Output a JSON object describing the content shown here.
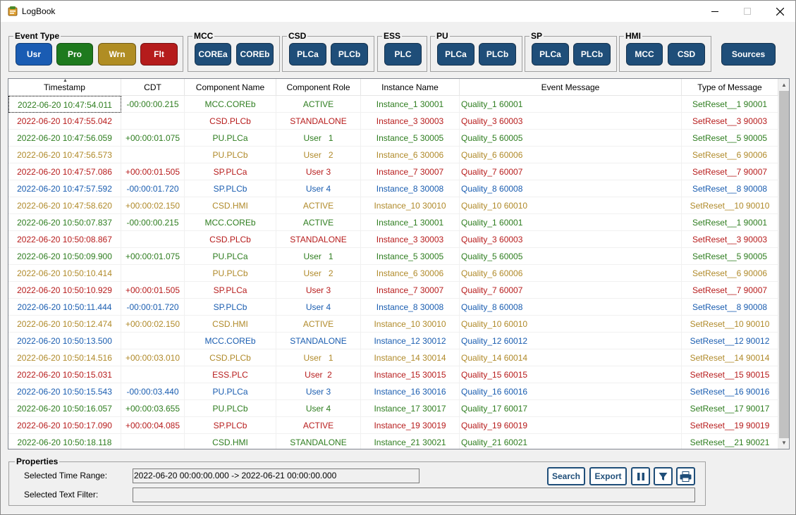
{
  "window": {
    "title": "LogBook"
  },
  "colors": {
    "blue": "#1a5db0",
    "green": "#2e7d1f",
    "yellow": "#b08a2a",
    "red": "#b71c1c",
    "navy": "#1f4e79"
  },
  "groups": [
    {
      "label": "Event Type",
      "buttons": [
        {
          "label": "Usr",
          "color": "#1a5cb3"
        },
        {
          "label": "Pro",
          "color": "#1e7a1e"
        },
        {
          "label": "Wrn",
          "color": "#b08d23"
        },
        {
          "label": "Flt",
          "color": "#b51c1c"
        }
      ]
    },
    {
      "label": "MCC",
      "buttons": [
        {
          "label": "COREa"
        },
        {
          "label": "COREb"
        }
      ]
    },
    {
      "label": "CSD",
      "buttons": [
        {
          "label": "PLCa"
        },
        {
          "label": "PLCb"
        }
      ]
    },
    {
      "label": "ESS",
      "buttons": [
        {
          "label": "PLC"
        }
      ]
    },
    {
      "label": "PU",
      "buttons": [
        {
          "label": "PLCa"
        },
        {
          "label": "PLCb"
        }
      ]
    },
    {
      "label": "SP",
      "buttons": [
        {
          "label": "PLCa"
        },
        {
          "label": "PLCb"
        }
      ]
    },
    {
      "label": "HMI",
      "buttons": [
        {
          "label": "MCC"
        },
        {
          "label": "CSD"
        }
      ]
    }
  ],
  "sources_label": "Sources",
  "table": {
    "columns": [
      "Timestamp",
      "CDT",
      "Component Name",
      "Component Role",
      "Instance Name",
      "Event Message",
      "Type of Message"
    ],
    "rows": [
      {
        "color": "green",
        "cells": [
          "2022-06-20 10:47:54.011",
          "-00:00:00.215",
          "MCC.COREb",
          "ACTIVE",
          "Instance_1 30001",
          "Quality_1 60001",
          "SetReset__1 90001"
        ]
      },
      {
        "color": "red",
        "cells": [
          "2022-06-20 10:47:55.042",
          "",
          "CSD.PLCb",
          "STANDALONE",
          "Instance_3 30003",
          "Quality_3 60003",
          "SetReset__3 90003"
        ]
      },
      {
        "color": "green",
        "cells": [
          "2022-06-20 10:47:56.059",
          "+00:00:01.075",
          "PU.PLCa",
          "User   1",
          "Instance_5 30005",
          "Quality_5 60005",
          "SetReset__5 90005"
        ]
      },
      {
        "color": "yellow",
        "cells": [
          "2022-06-20 10:47:56.573",
          "",
          "PU.PLCb",
          "User   2",
          "Instance_6 30006",
          "Quality_6 60006",
          "SetReset__6 90006"
        ]
      },
      {
        "color": "red",
        "cells": [
          "2022-06-20 10:47:57.086",
          "+00:00:01.505",
          "SP.PLCa",
          "User 3",
          "Instance_7 30007",
          "Quality_7 60007",
          "SetReset__7 90007"
        ]
      },
      {
        "color": "blue",
        "cells": [
          "2022-06-20 10:47:57.592",
          "-00:00:01.720",
          "SP.PLCb",
          "User 4",
          "Instance_8 30008",
          "Quality_8 60008",
          "SetReset__8 90008"
        ]
      },
      {
        "color": "yellow",
        "cells": [
          "2022-06-20 10:47:58.620",
          "+00:00:02.150",
          "CSD.HMI",
          "ACTIVE",
          "Instance_10 30010",
          "Quality_10 60010",
          "SetReset__10 90010"
        ]
      },
      {
        "color": "green",
        "cells": [
          "2022-06-20 10:50:07.837",
          "-00:00:00.215",
          "MCC.COREb",
          "ACTIVE",
          "Instance_1 30001",
          "Quality_1 60001",
          "SetReset__1 90001"
        ]
      },
      {
        "color": "red",
        "cells": [
          "2022-06-20 10:50:08.867",
          "",
          "CSD.PLCb",
          "STANDALONE",
          "Instance_3 30003",
          "Quality_3 60003",
          "SetReset__3 90003"
        ]
      },
      {
        "color": "green",
        "cells": [
          "2022-06-20 10:50:09.900",
          "+00:00:01.075",
          "PU.PLCa",
          "User   1",
          "Instance_5 30005",
          "Quality_5 60005",
          "SetReset__5 90005"
        ]
      },
      {
        "color": "yellow",
        "cells": [
          "2022-06-20 10:50:10.414",
          "",
          "PU.PLCb",
          "User   2",
          "Instance_6 30006",
          "Quality_6 60006",
          "SetReset__6 90006"
        ]
      },
      {
        "color": "red",
        "cells": [
          "2022-06-20 10:50:10.929",
          "+00:00:01.505",
          "SP.PLCa",
          "User 3",
          "Instance_7 30007",
          "Quality_7 60007",
          "SetReset__7 90007"
        ]
      },
      {
        "color": "blue",
        "cells": [
          "2022-06-20 10:50:11.444",
          "-00:00:01.720",
          "SP.PLCb",
          "User 4",
          "Instance_8 30008",
          "Quality_8 60008",
          "SetReset__8 90008"
        ]
      },
      {
        "color": "yellow",
        "cells": [
          "2022-06-20 10:50:12.474",
          "+00:00:02.150",
          "CSD.HMI",
          "ACTIVE",
          "Instance_10 30010",
          "Quality_10 60010",
          "SetReset__10 90010"
        ]
      },
      {
        "color": "blue",
        "cells": [
          "2022-06-20 10:50:13.500",
          "",
          "MCC.COREb",
          "STANDALONE",
          "Instance_12 30012",
          "Quality_12 60012",
          "SetReset__12 90012"
        ]
      },
      {
        "color": "yellow",
        "cells": [
          "2022-06-20 10:50:14.516",
          "+00:00:03.010",
          "CSD.PLCb",
          "User   1",
          "Instance_14 30014",
          "Quality_14 60014",
          "SetReset__14 90014"
        ]
      },
      {
        "color": "red",
        "cells": [
          "2022-06-20 10:50:15.031",
          "",
          "ESS.PLC",
          "User  2",
          "Instance_15 30015",
          "Quality_15 60015",
          "SetReset__15 90015"
        ]
      },
      {
        "color": "blue",
        "cells": [
          "2022-06-20 10:50:15.543",
          "-00:00:03.440",
          "PU.PLCa",
          "User 3",
          "Instance_16 30016",
          "Quality_16 60016",
          "SetReset__16 90016"
        ]
      },
      {
        "color": "green",
        "cells": [
          "2022-06-20 10:50:16.057",
          "+00:00:03.655",
          "PU.PLCb",
          "User 4",
          "Instance_17 30017",
          "Quality_17 60017",
          "SetReset__17 90017"
        ]
      },
      {
        "color": "red",
        "cells": [
          "2022-06-20 10:50:17.090",
          "+00:00:04.085",
          "SP.PLCb",
          "ACTIVE",
          "Instance_19 30019",
          "Quality_19 60019",
          "SetReset__19 90019"
        ]
      },
      {
        "color": "green",
        "cells": [
          "2022-06-20 10:50:18.118",
          "",
          "CSD.HMI",
          "STANDALONE",
          "Instance_21 30021",
          "Quality_21 60021",
          "SetReset__21 90021"
        ]
      }
    ]
  },
  "properties": {
    "label": "Properties",
    "time_range_label": "Selected Time Range:",
    "time_range_value": "2022-06-20 00:00:00.000 -> 2022-06-21 00:00:00.000",
    "text_filter_label": "Selected Text Filter:",
    "text_filter_value": "",
    "search_label": "Search",
    "export_label": "Export",
    "icons": [
      "pause-icon",
      "filter-icon",
      "print-icon"
    ]
  }
}
